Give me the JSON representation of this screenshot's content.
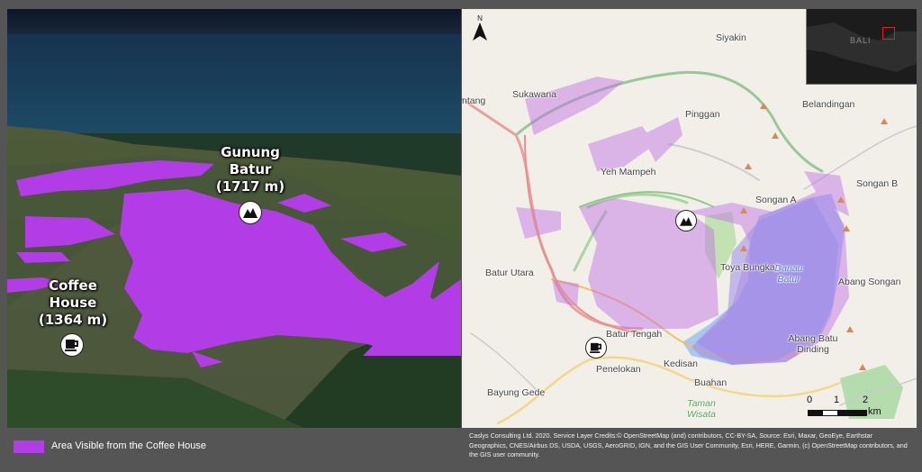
{
  "left_panel": {
    "peak_label": [
      "Gunung",
      "Batur",
      "(1717 m)"
    ],
    "coffee_label": [
      "Coffee",
      "House",
      "(1364 m)"
    ]
  },
  "right_panel": {
    "north_label": "N",
    "places": [
      "Siyakin",
      "Sukawana",
      "Belandingan",
      "Pinggan",
      "Yeh Mampeh",
      "Songan A",
      "Songan B",
      "Toya Bungkah",
      "Batur Utara",
      "Abang Songan",
      "Batur Tengah",
      "Abang Batu Dinding",
      "Penelokan",
      "Kedisan",
      "Bayung Gede",
      "Buahan",
      "ntang"
    ],
    "lake_label": "Danau Batur",
    "park_label": "Taman Wisata",
    "inset_label": "BALI",
    "scale": {
      "ticks": [
        "0",
        "1",
        "2"
      ],
      "unit": "km"
    }
  },
  "legend": {
    "label": "Area Visible from the Coffee House",
    "color": "#b23ce6"
  },
  "credits": "Caslys Consulting Ltd. 2020. Service Layer Credits:© OpenStreetMap (and) contributors, CC-BY-SA, Source: Esri, Maxar, GeoEye, Earthstar Geographics, CNES/Airbus DS, USDA, USGS, AeroGRID, IGN, and the GIS User Community, Esri, HERE, Garmin, (c) OpenStreetMap contributors, and the GIS user community.",
  "icons": {
    "peak": "mountain-icon",
    "coffee": "coffee-cup-icon",
    "north": "north-arrow-icon"
  },
  "colors": {
    "viewshed": "#b23ce6",
    "viewshed_map": "#d9a3ee",
    "lake": "#a9c8ee",
    "frame": "#555555"
  }
}
